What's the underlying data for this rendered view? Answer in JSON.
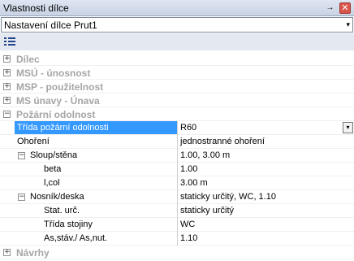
{
  "window": {
    "title": "Vlastnosti dílce",
    "pin_glyph": "→",
    "close_glyph": "✕"
  },
  "combo": {
    "value": "Nastavení dílce Prut1",
    "arrow": "▾"
  },
  "toolbar": {
    "icon": "list-view-icon"
  },
  "categories": [
    {
      "label": "Dílec",
      "expander": "+"
    },
    {
      "label": "MSÚ - únosnost",
      "expander": "+"
    },
    {
      "label": "MSP - použitelnost",
      "expander": "+"
    },
    {
      "label": "MS únavy - Únava",
      "expander": "+"
    },
    {
      "label": "Požární odolnost",
      "expander": "−"
    },
    {
      "label": "Návrhy",
      "expander": "+"
    }
  ],
  "properties": {
    "fire_class": {
      "name": "Třída požární odolnosti",
      "value": "R60",
      "dd": "▾"
    },
    "heating": {
      "name": "Ohoření",
      "value": "jednostranné ohoření"
    },
    "column": {
      "name": "Sloup/stěna",
      "value": "1.00, 3.00 m",
      "expander": "−"
    },
    "beta": {
      "name": "beta",
      "value": "1.00"
    },
    "lcol": {
      "name": "l,col",
      "value": "3.00 m"
    },
    "beam": {
      "name": "Nosník/deska",
      "value": "staticky určitý, WC, 1.10",
      "expander": "−"
    },
    "stat": {
      "name": "Stat. urč.",
      "value": "staticky určitý"
    },
    "trida_stojiny": {
      "name": "Třída stojiny",
      "value": "WC"
    },
    "as_ratio": {
      "name": "As,stáv./ As,nut.",
      "value": "1.10"
    }
  }
}
